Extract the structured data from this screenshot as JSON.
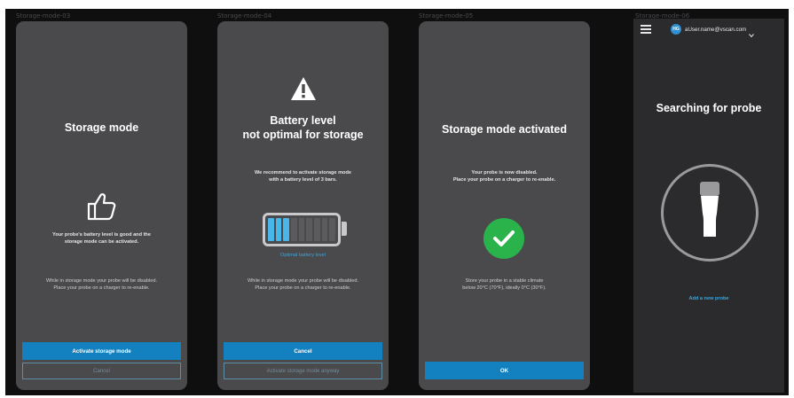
{
  "frames": [
    {
      "label": "Storage-mode-03",
      "title": "Storage mode",
      "icon": "thumbs-up-icon",
      "message": "Your probe's battery level is good and the\nstorage mode can be activated.",
      "note": "While in storage mode your probe will be disabled.\nPlace your probe on a charger to re-enable.",
      "primary_button": "Activate storage mode",
      "secondary_button": "Cancel"
    },
    {
      "label": "Storage-mode-04",
      "title": "Battery level\nnot optimal for storage",
      "icon": "warning-icon",
      "message": "We recommend to activate storage mode\nwith a battery level of  3 bars.",
      "battery": {
        "bars_total": 9,
        "bars_filled": 3
      },
      "battery_caption": "Optimal battery level",
      "note": "While in storage mode your probe will be disabled.\nPlace your probe on a charger to re-enable.",
      "primary_button": "Cancel",
      "secondary_button": "Activate storage mode anyway"
    },
    {
      "label": "Storage-mode-05",
      "title": "Storage mode activated",
      "icon": "check-circle-icon",
      "message": "Your probe is now disabled.\nPlace your probe on a charger to re-enable.",
      "note": "Store your probe in a stable climate\nbelow 20°C (70°F), ideally 0°C (30°F).",
      "primary_button": "OK"
    },
    {
      "label": "Storage-mode-06",
      "menu_icon": "hamburger-menu-icon",
      "avatar_initials": "HG",
      "user": "aUser.name@vscan.com",
      "title": "Searching for probe",
      "icon": "probe-icon",
      "link": "Add a new probe"
    }
  ],
  "colors": {
    "panel": "#4a4a4c",
    "dark_panel": "#2b2b2d",
    "primary": "#1381c0",
    "success": "#2bb34b",
    "battery_fill": "#49b6ea",
    "link": "#3aa4dc"
  }
}
